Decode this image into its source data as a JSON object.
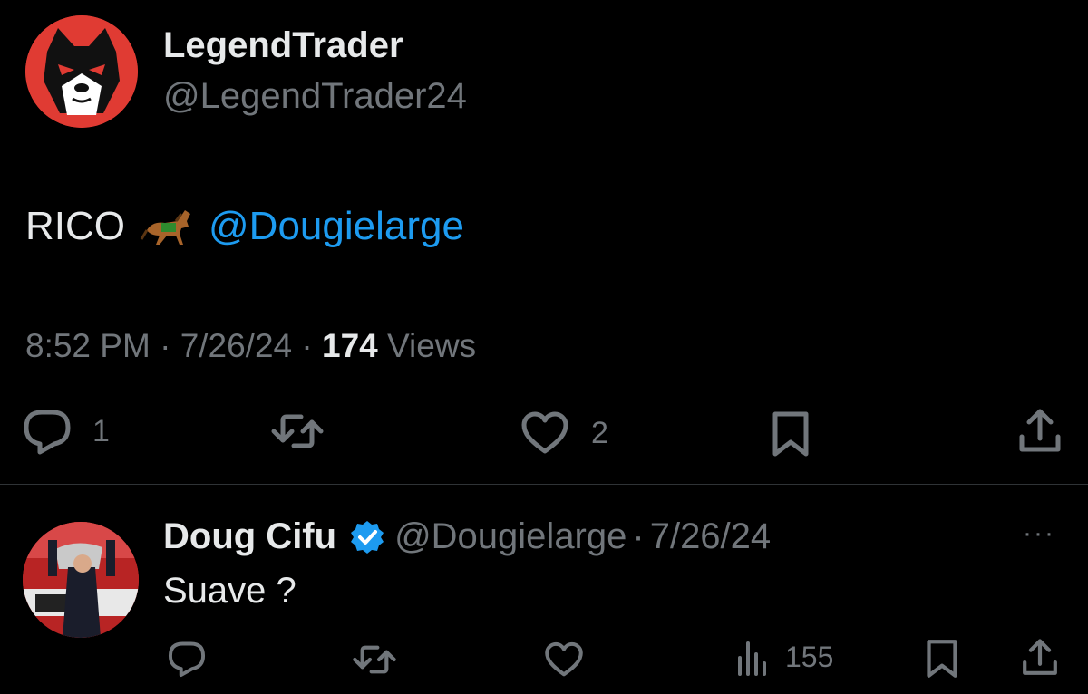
{
  "tweet": {
    "author_name": "LegendTrader",
    "author_handle": "@LegendTrader24",
    "text_prefix": "RICO",
    "mention": "@Dougielarge",
    "time": "8:52 PM",
    "date": "7/26/24",
    "views_count": "174",
    "views_label": "Views",
    "separator": "·",
    "actions": {
      "reply_count": "1",
      "like_count": "2"
    }
  },
  "reply": {
    "author_name": "Doug Cifu",
    "author_handle": "@Dougielarge",
    "separator": "·",
    "date": "7/26/24",
    "text": "Suave ?",
    "more": "···",
    "views_count": "155"
  },
  "colors": {
    "background": "#000000",
    "text": "#e7e9ea",
    "muted": "#71767b",
    "accent": "#1d9bf0",
    "avatar_red": "#e03b33"
  }
}
